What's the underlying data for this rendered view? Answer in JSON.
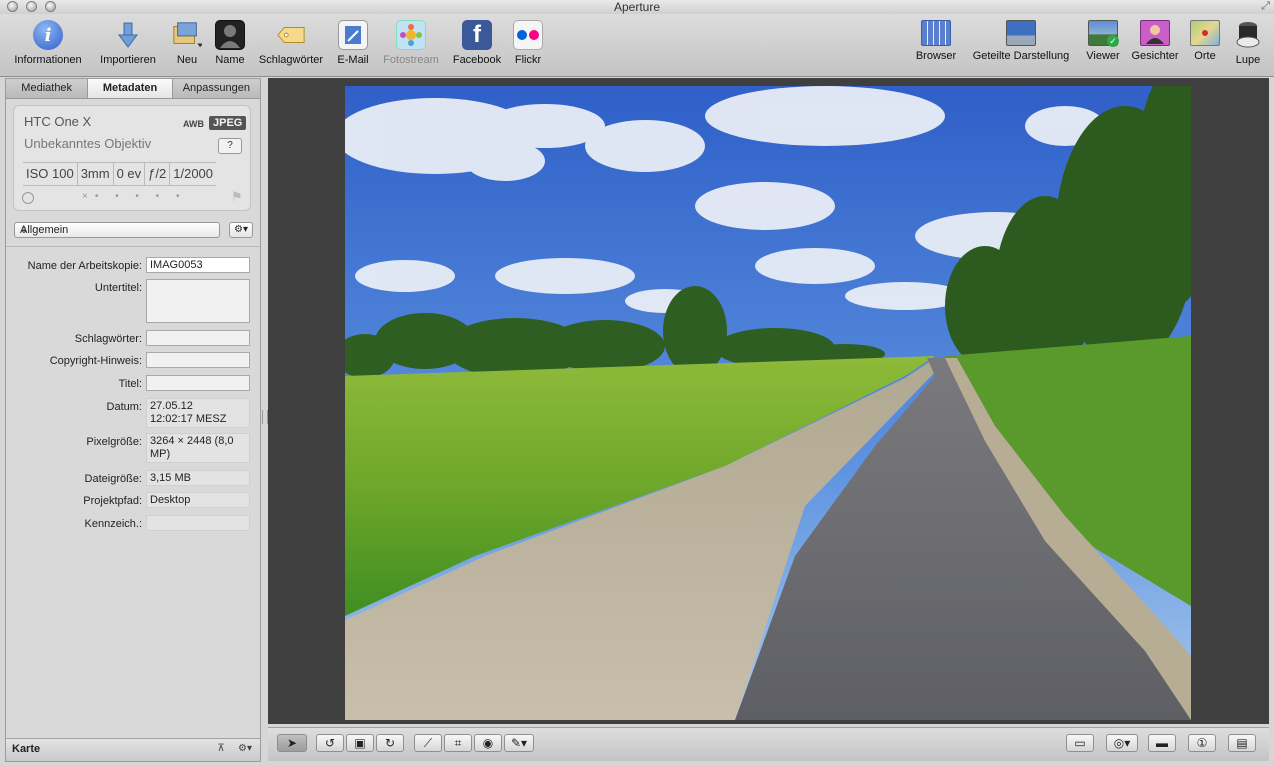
{
  "window": {
    "title": "Aperture"
  },
  "toolbar": {
    "left": [
      {
        "id": "informationen",
        "label": "Informationen",
        "icon": "info-icon"
      },
      {
        "id": "importieren",
        "label": "Importieren",
        "icon": "import-arrow-icon"
      },
      {
        "id": "neu",
        "label": "Neu",
        "icon": "new-project-icon"
      },
      {
        "id": "name",
        "label": "Name",
        "icon": "person-name-icon"
      },
      {
        "id": "schlagwoerter",
        "label": "Schlagwörter",
        "icon": "tag-icon"
      },
      {
        "id": "email",
        "label": "E-Mail",
        "icon": "email-icon"
      },
      {
        "id": "fotostream",
        "label": "Fotostream",
        "icon": "photostream-icon"
      },
      {
        "id": "facebook",
        "label": "Facebook",
        "icon": "facebook-icon"
      },
      {
        "id": "flickr",
        "label": "Flickr",
        "icon": "flickr-icon"
      }
    ],
    "right": [
      {
        "id": "browser",
        "label": "Browser",
        "icon": "browser-grid-icon"
      },
      {
        "id": "geteilte",
        "label": "Geteilte Darstellung",
        "icon": "split-view-icon"
      },
      {
        "id": "viewer",
        "label": "Viewer",
        "icon": "viewer-icon"
      },
      {
        "id": "gesichter",
        "label": "Gesichter",
        "icon": "faces-icon"
      },
      {
        "id": "orte",
        "label": "Orte",
        "icon": "places-map-icon"
      },
      {
        "id": "lupe",
        "label": "Lupe",
        "icon": "loupe-icon"
      }
    ]
  },
  "sidebar": {
    "tabs": [
      "Mediathek",
      "Metadaten",
      "Anpassungen"
    ],
    "active_tab": "Metadaten",
    "camera": {
      "model": "HTC One X",
      "lens": "Unbekanntes Objektiv",
      "awb": "AWB",
      "format": "JPEG",
      "help": "?",
      "exif": [
        "ISO 100",
        "3mm",
        "0 ev",
        "ƒ/2",
        "1/2000"
      ],
      "reject_mark": "×",
      "rating_dots": "• • • • •"
    },
    "preset": "Allgemein",
    "fields": [
      {
        "label": "Name der Arbeitskopie:",
        "value": "IMAG0053",
        "style": "white"
      },
      {
        "label": "Untertitel:",
        "value": "",
        "style": "input",
        "tall": true
      },
      {
        "label": "Schlagwörter:",
        "value": "",
        "style": "input"
      },
      {
        "label": "Copyright-Hinweis:",
        "value": "",
        "style": "input"
      },
      {
        "label": "Titel:",
        "value": "",
        "style": "input"
      },
      {
        "label": "Datum:",
        "value": "27.05.12\n12:02:17 MESZ",
        "style": "ro",
        "lines": 2
      },
      {
        "label": "Pixelgröße:",
        "value": "3264 × 2448 (8,0 MP)",
        "style": "ro",
        "lines": 2
      },
      {
        "label": "Dateigröße:",
        "value": "3,15 MB",
        "style": "ro"
      },
      {
        "label": "Projektpfad:",
        "value": "Desktop",
        "style": "ro"
      },
      {
        "label": "Kennzeich.:",
        "value": "",
        "style": "ro"
      }
    ],
    "footer": {
      "label": "Karte"
    }
  },
  "photo": {
    "subject": "countryside-path-photo"
  },
  "colors": {
    "viewer_bg": "#3f3f3f",
    "sidebar_bg": "#d9d9d9",
    "facebook": "#3b5998",
    "info_blue": "#3c6fd0"
  }
}
